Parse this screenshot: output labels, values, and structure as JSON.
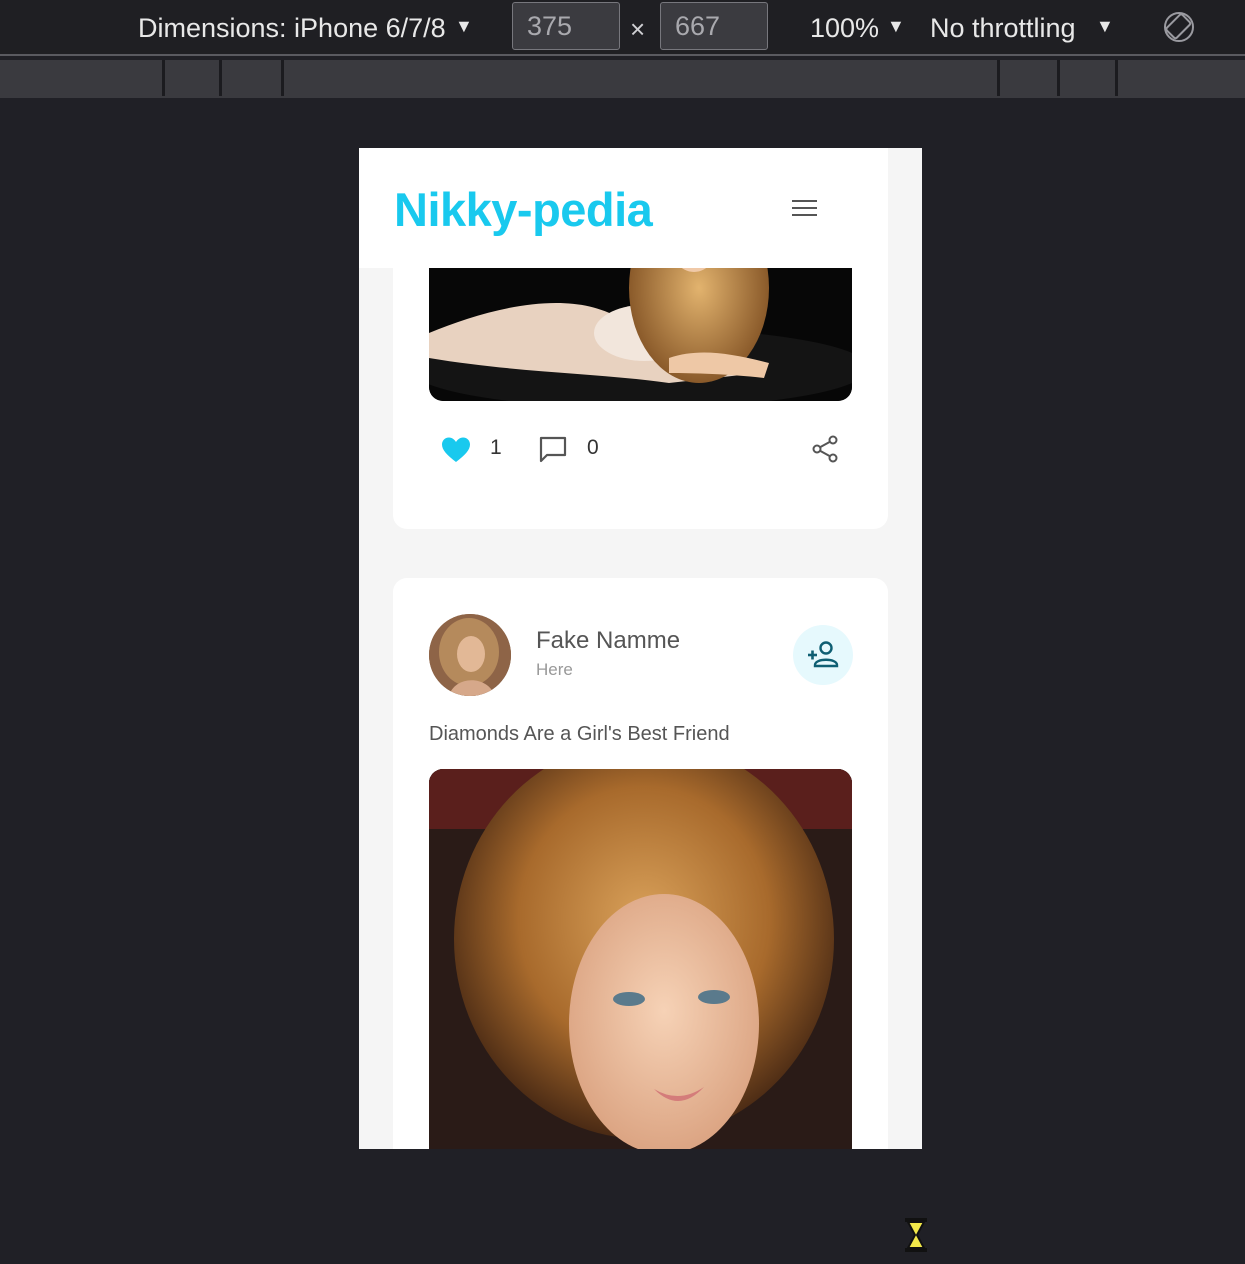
{
  "devtools": {
    "dimensions_label": "Dimensions: iPhone 6/7/8",
    "width_value": "375",
    "height_value": "667",
    "times_symbol": "×",
    "zoom_label": "100%",
    "throttling_label": "No throttling",
    "caret": "▼"
  },
  "app": {
    "brand": "Nikky-pedia",
    "brand_color": "#19c9ee"
  },
  "posts": [
    {
      "likes": "1",
      "comments": "0",
      "liked": true
    },
    {
      "author": "Fake Namme",
      "location": "Here",
      "caption": "Diamonds Are a Girl's Best Friend"
    }
  ],
  "icons": {
    "menu": "hamburger-menu-icon",
    "like": "heart-icon",
    "comment": "comment-icon",
    "share": "share-icon",
    "follow": "add-person-icon",
    "rotate": "rotate-device-icon",
    "cursor": "hourglass-icon"
  }
}
